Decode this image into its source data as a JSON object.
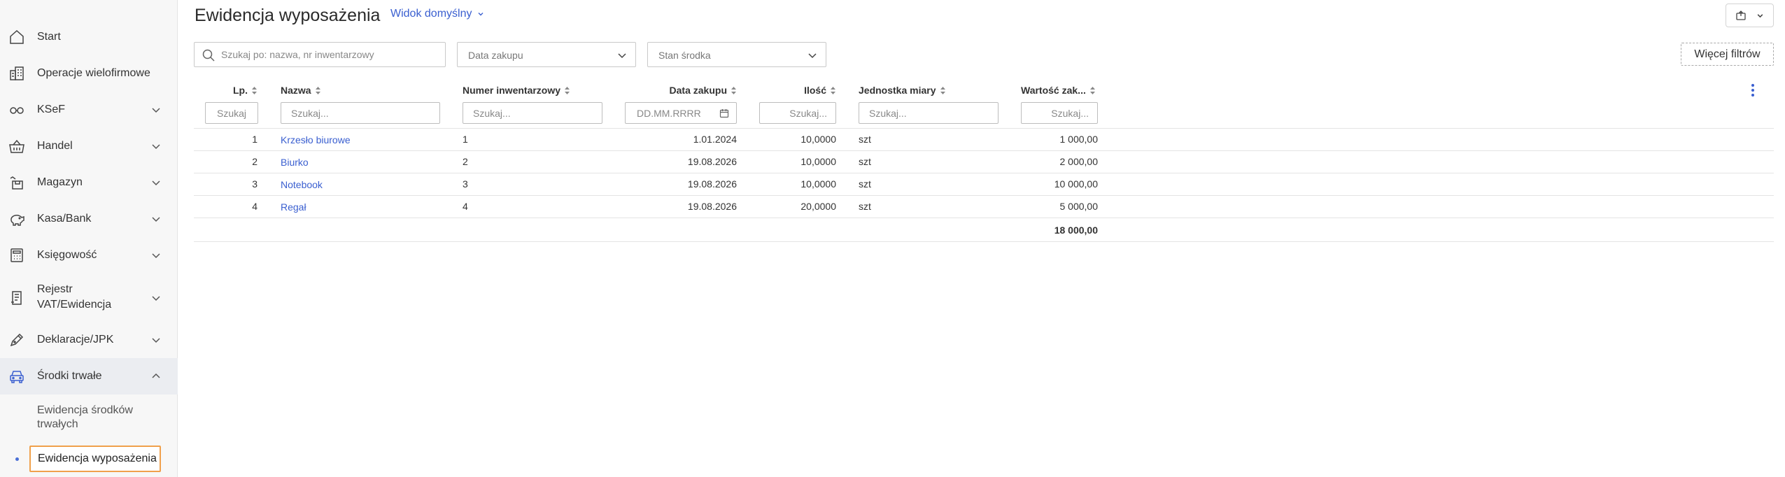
{
  "sidebar": {
    "items": [
      {
        "label": "Start",
        "icon": "home-icon",
        "has_chevron": false
      },
      {
        "label": "Operacje wielofirmowe",
        "icon": "companies-icon",
        "has_chevron": false
      },
      {
        "label": "KSeF",
        "icon": "ksef-icon",
        "has_chevron": true
      },
      {
        "label": "Handel",
        "icon": "basket-icon",
        "has_chevron": true
      },
      {
        "label": "Magazyn",
        "icon": "warehouse-icon",
        "has_chevron": true
      },
      {
        "label": "Kasa/Bank",
        "icon": "piggy-bank-icon",
        "has_chevron": true
      },
      {
        "label": "Księgowość",
        "icon": "calculator-icon",
        "has_chevron": true
      },
      {
        "label_line1": "Rejestr",
        "label_line2": "VAT/Ewidencja",
        "icon": "register-icon",
        "has_chevron": true
      },
      {
        "label": "Deklaracje/JPK",
        "icon": "pen-icon",
        "has_chevron": true
      },
      {
        "label": "Środki trwałe",
        "icon": "car-icon",
        "has_chevron": true,
        "expanded": true
      }
    ],
    "subitems": [
      {
        "label_line1": "Ewidencja środków",
        "label_line2": "trwałych"
      },
      {
        "label": "Ewidencja wyposażenia",
        "active": true
      }
    ]
  },
  "header": {
    "title": "Ewidencja wyposażenia",
    "view_label": "Widok domyślny"
  },
  "filters": {
    "search_placeholder": "Szukaj po: nazwa, nr inwentarzowy",
    "purchase_date_label": "Data zakupu",
    "asset_state_label": "Stan środka",
    "more_filters_label": "Więcej filtrów"
  },
  "table": {
    "columns": [
      {
        "label": "Lp.",
        "placeholder": "Szukaj"
      },
      {
        "label": "Nazwa",
        "placeholder": "Szukaj..."
      },
      {
        "label": "Numer inwentarzowy",
        "placeholder": "Szukaj..."
      },
      {
        "label": "Data zakupu",
        "placeholder": "DD.MM.RRRR"
      },
      {
        "label": "Ilość",
        "placeholder": "Szukaj..."
      },
      {
        "label": "Jednostka miary",
        "placeholder": "Szukaj..."
      },
      {
        "label": "Wartość zak...",
        "placeholder": "Szukaj..."
      }
    ],
    "rows": [
      {
        "lp": "1",
        "nazwa": "Krzesło biurowe",
        "numer": "1",
        "data": "1.01.2024",
        "ilosc": "10,0000",
        "jm": "szt",
        "wartosc": "1 000,00"
      },
      {
        "lp": "2",
        "nazwa": "Biurko",
        "numer": "2",
        "data": "19.08.2026",
        "ilosc": "10,0000",
        "jm": "szt",
        "wartosc": "2 000,00"
      },
      {
        "lp": "3",
        "nazwa": "Notebook",
        "numer": "3",
        "data": "19.08.2026",
        "ilosc": "10,0000",
        "jm": "szt",
        "wartosc": "10 000,00"
      },
      {
        "lp": "4",
        "nazwa": "Regał",
        "numer": "4",
        "data": "19.08.2026",
        "ilosc": "20,0000",
        "jm": "szt",
        "wartosc": "5 000,00"
      }
    ],
    "total": "18 000,00"
  },
  "colors": {
    "accent": "#3a5fd0",
    "active_outline": "#f0a04b",
    "sidebar_bg": "#f7f7f7"
  }
}
